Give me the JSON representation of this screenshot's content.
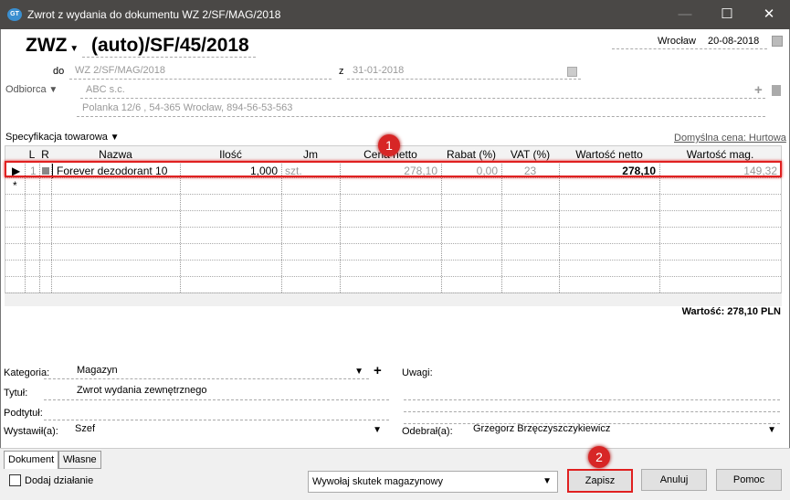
{
  "window": {
    "title": "Zwrot z wydania do dokumentu WZ 2/SF/MAG/2018",
    "minimize": "—",
    "maximize": "☐",
    "close": "✕",
    "logo": "GT"
  },
  "header": {
    "doc_type": "ZWZ",
    "doc_number": "(auto)/SF/45/2018",
    "city": "Wrocław",
    "date": "20-08-2018",
    "do_label": "do",
    "do_value": "WZ 2/SF/MAG/2018",
    "z_label": "z",
    "z_value": "31-01-2018",
    "odbiorca_label": "Odbiorca",
    "odbiorca_name": "ABC s.c.",
    "odbiorca_address": "Polanka  12/6 , 54-365 Wrocław, 894-56-53-563"
  },
  "spec": {
    "label": "Specyfikacja towarowa",
    "default_price": "Domyślna cena: Hurtowa"
  },
  "table": {
    "columns": [
      "L",
      "R",
      "Nazwa",
      "Ilość",
      "Jm",
      "Cena netto",
      "Rabat (%)",
      "VAT (%)",
      "Wartość netto",
      "Wartość mag."
    ],
    "rows": [
      {
        "L": "1",
        "Nazwa": "Forever dezodorant 10",
        "Ilosc": "1,000",
        "Jm": "szt.",
        "Cena": "278,10",
        "Rabat": "0,00",
        "VAT": "23",
        "WartoscNetto": "278,10",
        "WartoscMag": "149,32"
      }
    ],
    "new_row_marker": "*"
  },
  "total": "Wartość: 278,10 PLN",
  "annotations": {
    "badge1": "1",
    "badge2": "2"
  },
  "form": {
    "kategoria_label": "Kategoria:",
    "kategoria": "Magazyn",
    "tytul_label": "Tytuł:",
    "tytul": "Zwrot wydania zewnętrznego",
    "podtytul_label": "Podtytuł:",
    "podtytul": "",
    "wystawil_label": "Wystawił(a):",
    "wystawil": "Szef",
    "uwagi_label": "Uwagi:",
    "odebral_label": "Odebrał(a):",
    "odebral": "Grzegorz Brzęczyszczykiewicz"
  },
  "tabs": [
    "Dokument",
    "Własne"
  ],
  "footer": {
    "dodaj": "Dodaj działanie",
    "skutek": "Wywołaj skutek magazynowy",
    "zapisz": "Zapisz",
    "anuluj": "Anuluj",
    "pomoc": "Pomoc"
  }
}
